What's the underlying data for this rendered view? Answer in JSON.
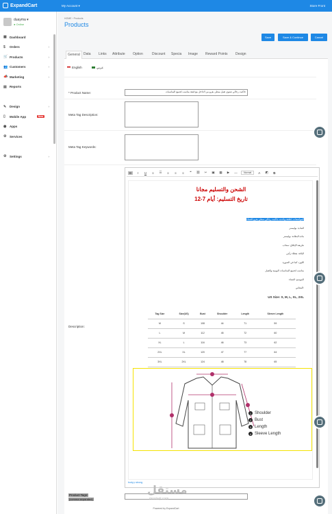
{
  "header": {
    "brand": "ExpandCart",
    "account_menu": "My Account ▾",
    "store_link": "Store Front"
  },
  "user": {
    "name": "duayma ▾",
    "status": "● Online"
  },
  "sidebar": {
    "items": [
      {
        "label": "Dashboard",
        "icon": "dashboard-icon",
        "glyph": "▦",
        "chevron": false
      },
      {
        "label": "Orders",
        "icon": "dollar-icon",
        "glyph": "$",
        "chevron": true
      },
      {
        "label": "Products",
        "icon": "cart-icon",
        "glyph": "🛒",
        "chevron": true
      },
      {
        "label": "Customers",
        "icon": "users-icon",
        "glyph": "👥",
        "chevron": true
      },
      {
        "label": "Marketing",
        "icon": "megaphone-icon",
        "glyph": "📣",
        "chevron": true
      },
      {
        "label": "Reports",
        "icon": "chart-icon",
        "glyph": "▤",
        "chevron": false
      },
      {
        "label": "Design",
        "icon": "brush-icon",
        "glyph": "✎",
        "chevron": true
      },
      {
        "label": "Mobile App",
        "icon": "mobile-icon",
        "glyph": "▯",
        "chevron": false,
        "badge": "New"
      },
      {
        "label": "Apps",
        "icon": "apps-icon",
        "glyph": "⬢",
        "chevron": false
      },
      {
        "label": "Services",
        "icon": "services-icon",
        "glyph": "⚙",
        "chevron": false
      },
      {
        "label": "Settings",
        "icon": "gear-icon",
        "glyph": "⚙",
        "chevron": true
      }
    ]
  },
  "breadcrumb": {
    "home": "HOME",
    "sep": "›",
    "current": "Products"
  },
  "page_title": "Products",
  "actions": {
    "save": "Save",
    "save_continue": "Save & Continue",
    "cancel": "Cancel"
  },
  "tabs": [
    "General",
    "Data",
    "Links",
    "Attribute",
    "Option",
    "Discount",
    "Specia",
    "Image",
    "Reward Points",
    "Design"
  ],
  "languages": {
    "english": "English",
    "arabic": "عربي"
  },
  "form": {
    "product_name_label": "* Product Name:",
    "product_name_value": "جاكيت رجالي شتوي ثقيل مبطن بفرو من الداخل مع قبعة مناسب لجميع المناسبات",
    "meta_desc_label": "Meta Tag Description:",
    "meta_keywords_label": "Meta Tag Keywords:",
    "description_label": "Description:",
    "tags_label": "Product Tags:",
    "tags_sub": "(comma separated)"
  },
  "editor": {
    "heading1": "الشحن والتسليم مجانا",
    "heading2": "تاريخ التسليم: أيام 7-12",
    "lines": [
      "المواصفات: قطعة واحدة، جاكيت رجالي مبطن بفرو للشتاء",
      "المادة: بوليستر",
      "مادة البطانة: بوليستر",
      "طريقة الإغلاق: سحاب",
      "الياقة: بغطاء رأس",
      "اللون: كما في الصورة",
      "مناسب لجميع المناسبات اليومية والعمل",
      "الموسم: الشتاء",
      "المقاس:",
      "US Size: S, M, L, XL, 2XL"
    ],
    "table_headers": [
      "Tag Size",
      "Size(US)",
      "Bust",
      "Shoulder",
      "Length",
      "Sleeve Length"
    ],
    "table_rows": [
      [
        "M",
        "S",
        "108",
        "44",
        "71",
        "59"
      ],
      [
        "L",
        "M",
        "112",
        "45",
        "72",
        "60"
      ],
      [
        "XL",
        "L",
        "116",
        "46",
        "73",
        "62"
      ],
      [
        "2XL",
        "XL",
        "120",
        "47",
        "77",
        "64"
      ],
      [
        "3XL",
        "2XL",
        "124",
        "48",
        "78",
        "65"
      ]
    ],
    "legend": [
      "Shoulder",
      "Bust",
      "Length",
      "Sleeve Length"
    ],
    "status": "body p strong",
    "format_select": "Normal"
  },
  "footer": "Powered by ExpandCart",
  "watermark": {
    "arabic": "مستقل",
    "latin": "mostaql.com"
  },
  "colors": {
    "primary": "#1e88e5",
    "danger": "#e53935",
    "heading_red": "#cc0000"
  }
}
